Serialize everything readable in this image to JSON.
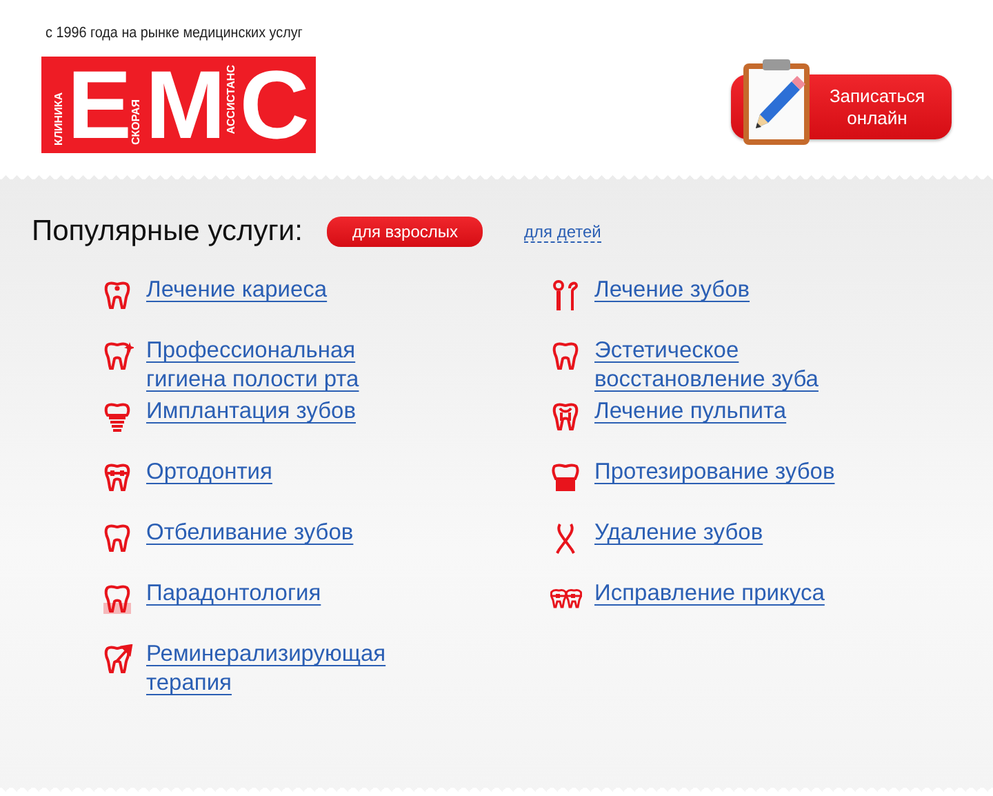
{
  "header": {
    "tagline": "с 1996 года на рынке медицинских услуг",
    "logo": {
      "letters": [
        "E",
        "M",
        "C"
      ],
      "captions": [
        "КЛИНИКА",
        "СКОРАЯ",
        "АССИСТАНС"
      ]
    },
    "signup_button": {
      "lines": [
        "Записаться",
        "онлайн"
      ]
    }
  },
  "services": {
    "title": "Популярные услуги:",
    "tabs": [
      {
        "label": "для взрослых",
        "selected": true
      },
      {
        "label": "для детей",
        "selected": false
      }
    ],
    "columns": [
      [
        {
          "label": "Лечение кариеса",
          "kind": "caries"
        },
        {
          "label": "Профессиональная гигиена полости рта",
          "kind": "sparkle"
        },
        {
          "label": "Имплантация зубов",
          "kind": "implant"
        },
        {
          "label": "Ортодонтия",
          "kind": "bracket"
        },
        {
          "label": "Отбеливание зубов",
          "kind": "tooth"
        },
        {
          "label": "Парадонтология",
          "kind": "gum"
        },
        {
          "label": "Реминерализирующая терапия",
          "kind": "arrow"
        }
      ],
      [
        {
          "label": "Лечение зубов",
          "kind": "probe"
        },
        {
          "label": "Эстетическое восстановление зуба",
          "kind": "tooth"
        },
        {
          "label": "Лечение пульпита",
          "kind": "pulp"
        },
        {
          "label": "Протезирование зубов",
          "kind": "crown"
        },
        {
          "label": "Удаление зубов",
          "kind": "forceps"
        },
        {
          "label": "Исправление прикуса",
          "kind": "braces"
        }
      ]
    ]
  }
}
